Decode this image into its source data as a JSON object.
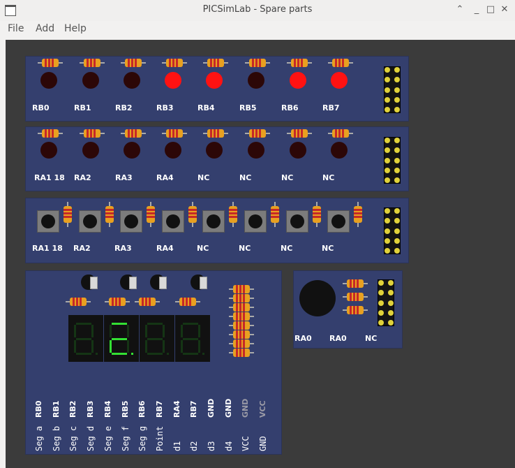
{
  "window": {
    "title": "PICSimLab - Spare parts",
    "minimize_icon": "chevron-up",
    "restore_icon": "square",
    "close_icon": "x"
  },
  "menu": [
    {
      "label": "File"
    },
    {
      "label": "Add"
    },
    {
      "label": "Help"
    }
  ],
  "colors": {
    "board": "#343f6e",
    "led_on": "#ff1212",
    "led_off": "#2c0707",
    "segment_on": "#33e033",
    "resistor": "#e8a020"
  },
  "led_bar_1": {
    "leds": [
      {
        "label": "RB0",
        "on": false
      },
      {
        "label": "RB1",
        "on": false
      },
      {
        "label": "RB2",
        "on": false
      },
      {
        "label": "RB3",
        "on": true
      },
      {
        "label": "RB4",
        "on": true
      },
      {
        "label": "RB5",
        "on": false
      },
      {
        "label": "RB6",
        "on": true
      },
      {
        "label": "RB7",
        "on": true
      }
    ]
  },
  "led_bar_2": {
    "leds": [
      {
        "label": "RA1 18",
        "on": false
      },
      {
        "label": "RA2",
        "on": false
      },
      {
        "label": "RA3",
        "on": false
      },
      {
        "label": "RA4",
        "on": false
      },
      {
        "label": "NC",
        "on": false
      },
      {
        "label": "NC",
        "on": false
      },
      {
        "label": "NC",
        "on": false
      },
      {
        "label": "NC",
        "on": false
      }
    ]
  },
  "push_buttons": {
    "buttons": [
      {
        "label": "RA1 18"
      },
      {
        "label": "RA2"
      },
      {
        "label": "RA3"
      },
      {
        "label": "RA4"
      },
      {
        "label": "NC"
      },
      {
        "label": "NC"
      },
      {
        "label": "NC"
      },
      {
        "label": "NC"
      }
    ]
  },
  "seven_segment": {
    "digits": [
      {
        "on_segments": []
      },
      {
        "on_segments": [
          "a",
          "e",
          "d",
          "g",
          "dp"
        ]
      },
      {
        "on_segments": []
      },
      {
        "on_segments": []
      }
    ],
    "pins": [
      {
        "func": "Seg a",
        "conn": "RB0",
        "active": true
      },
      {
        "func": "Seg b",
        "conn": "RB1",
        "active": true
      },
      {
        "func": "Seg c",
        "conn": "RB2",
        "active": true
      },
      {
        "func": "Seg d",
        "conn": "RB3",
        "active": true
      },
      {
        "func": "Seg e",
        "conn": "RB4",
        "active": true
      },
      {
        "func": "Seg f",
        "conn": "RB5",
        "active": true
      },
      {
        "func": "Seg g",
        "conn": "RB6",
        "active": true
      },
      {
        "func": "Point",
        "conn": "RB7",
        "active": true
      },
      {
        "func": "d1",
        "conn": "RA4",
        "active": true
      },
      {
        "func": "d2",
        "conn": "RB7",
        "active": true
      },
      {
        "func": "d3",
        "conn": "GND",
        "active": true
      },
      {
        "func": "d4",
        "conn": "GND",
        "active": true
      },
      {
        "func": "VCC",
        "conn": "GND",
        "active": false
      },
      {
        "func": "GND",
        "conn": "VCC",
        "active": false
      }
    ]
  },
  "buzzer": {
    "labels": [
      "RA0",
      "RA0",
      "NC"
    ]
  }
}
